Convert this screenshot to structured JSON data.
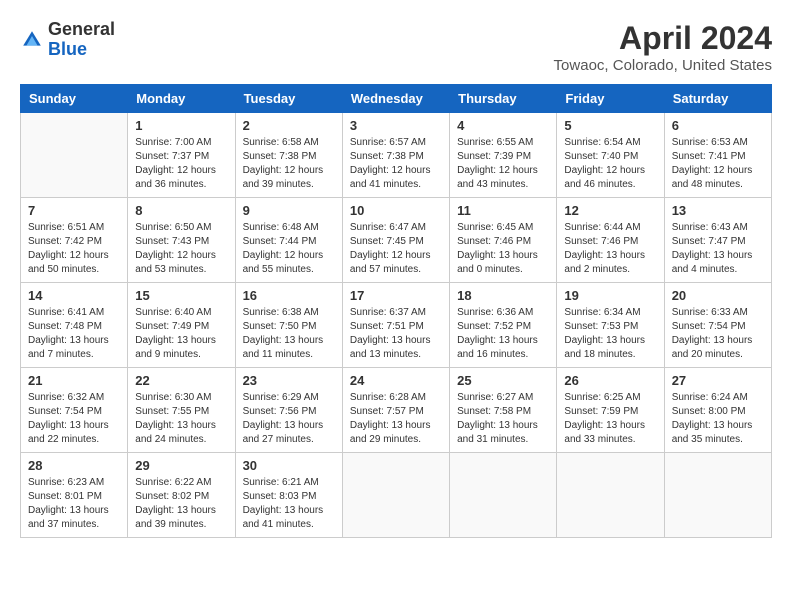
{
  "header": {
    "logo_general": "General",
    "logo_blue": "Blue",
    "month": "April 2024",
    "location": "Towaoc, Colorado, United States"
  },
  "days_of_week": [
    "Sunday",
    "Monday",
    "Tuesday",
    "Wednesday",
    "Thursday",
    "Friday",
    "Saturday"
  ],
  "weeks": [
    [
      {
        "num": "",
        "sunrise": "",
        "sunset": "",
        "daylight": ""
      },
      {
        "num": "1",
        "sunrise": "Sunrise: 7:00 AM",
        "sunset": "Sunset: 7:37 PM",
        "daylight": "Daylight: 12 hours and 36 minutes."
      },
      {
        "num": "2",
        "sunrise": "Sunrise: 6:58 AM",
        "sunset": "Sunset: 7:38 PM",
        "daylight": "Daylight: 12 hours and 39 minutes."
      },
      {
        "num": "3",
        "sunrise": "Sunrise: 6:57 AM",
        "sunset": "Sunset: 7:38 PM",
        "daylight": "Daylight: 12 hours and 41 minutes."
      },
      {
        "num": "4",
        "sunrise": "Sunrise: 6:55 AM",
        "sunset": "Sunset: 7:39 PM",
        "daylight": "Daylight: 12 hours and 43 minutes."
      },
      {
        "num": "5",
        "sunrise": "Sunrise: 6:54 AM",
        "sunset": "Sunset: 7:40 PM",
        "daylight": "Daylight: 12 hours and 46 minutes."
      },
      {
        "num": "6",
        "sunrise": "Sunrise: 6:53 AM",
        "sunset": "Sunset: 7:41 PM",
        "daylight": "Daylight: 12 hours and 48 minutes."
      }
    ],
    [
      {
        "num": "7",
        "sunrise": "Sunrise: 6:51 AM",
        "sunset": "Sunset: 7:42 PM",
        "daylight": "Daylight: 12 hours and 50 minutes."
      },
      {
        "num": "8",
        "sunrise": "Sunrise: 6:50 AM",
        "sunset": "Sunset: 7:43 PM",
        "daylight": "Daylight: 12 hours and 53 minutes."
      },
      {
        "num": "9",
        "sunrise": "Sunrise: 6:48 AM",
        "sunset": "Sunset: 7:44 PM",
        "daylight": "Daylight: 12 hours and 55 minutes."
      },
      {
        "num": "10",
        "sunrise": "Sunrise: 6:47 AM",
        "sunset": "Sunset: 7:45 PM",
        "daylight": "Daylight: 12 hours and 57 minutes."
      },
      {
        "num": "11",
        "sunrise": "Sunrise: 6:45 AM",
        "sunset": "Sunset: 7:46 PM",
        "daylight": "Daylight: 13 hours and 0 minutes."
      },
      {
        "num": "12",
        "sunrise": "Sunrise: 6:44 AM",
        "sunset": "Sunset: 7:46 PM",
        "daylight": "Daylight: 13 hours and 2 minutes."
      },
      {
        "num": "13",
        "sunrise": "Sunrise: 6:43 AM",
        "sunset": "Sunset: 7:47 PM",
        "daylight": "Daylight: 13 hours and 4 minutes."
      }
    ],
    [
      {
        "num": "14",
        "sunrise": "Sunrise: 6:41 AM",
        "sunset": "Sunset: 7:48 PM",
        "daylight": "Daylight: 13 hours and 7 minutes."
      },
      {
        "num": "15",
        "sunrise": "Sunrise: 6:40 AM",
        "sunset": "Sunset: 7:49 PM",
        "daylight": "Daylight: 13 hours and 9 minutes."
      },
      {
        "num": "16",
        "sunrise": "Sunrise: 6:38 AM",
        "sunset": "Sunset: 7:50 PM",
        "daylight": "Daylight: 13 hours and 11 minutes."
      },
      {
        "num": "17",
        "sunrise": "Sunrise: 6:37 AM",
        "sunset": "Sunset: 7:51 PM",
        "daylight": "Daylight: 13 hours and 13 minutes."
      },
      {
        "num": "18",
        "sunrise": "Sunrise: 6:36 AM",
        "sunset": "Sunset: 7:52 PM",
        "daylight": "Daylight: 13 hours and 16 minutes."
      },
      {
        "num": "19",
        "sunrise": "Sunrise: 6:34 AM",
        "sunset": "Sunset: 7:53 PM",
        "daylight": "Daylight: 13 hours and 18 minutes."
      },
      {
        "num": "20",
        "sunrise": "Sunrise: 6:33 AM",
        "sunset": "Sunset: 7:54 PM",
        "daylight": "Daylight: 13 hours and 20 minutes."
      }
    ],
    [
      {
        "num": "21",
        "sunrise": "Sunrise: 6:32 AM",
        "sunset": "Sunset: 7:54 PM",
        "daylight": "Daylight: 13 hours and 22 minutes."
      },
      {
        "num": "22",
        "sunrise": "Sunrise: 6:30 AM",
        "sunset": "Sunset: 7:55 PM",
        "daylight": "Daylight: 13 hours and 24 minutes."
      },
      {
        "num": "23",
        "sunrise": "Sunrise: 6:29 AM",
        "sunset": "Sunset: 7:56 PM",
        "daylight": "Daylight: 13 hours and 27 minutes."
      },
      {
        "num": "24",
        "sunrise": "Sunrise: 6:28 AM",
        "sunset": "Sunset: 7:57 PM",
        "daylight": "Daylight: 13 hours and 29 minutes."
      },
      {
        "num": "25",
        "sunrise": "Sunrise: 6:27 AM",
        "sunset": "Sunset: 7:58 PM",
        "daylight": "Daylight: 13 hours and 31 minutes."
      },
      {
        "num": "26",
        "sunrise": "Sunrise: 6:25 AM",
        "sunset": "Sunset: 7:59 PM",
        "daylight": "Daylight: 13 hours and 33 minutes."
      },
      {
        "num": "27",
        "sunrise": "Sunrise: 6:24 AM",
        "sunset": "Sunset: 8:00 PM",
        "daylight": "Daylight: 13 hours and 35 minutes."
      }
    ],
    [
      {
        "num": "28",
        "sunrise": "Sunrise: 6:23 AM",
        "sunset": "Sunset: 8:01 PM",
        "daylight": "Daylight: 13 hours and 37 minutes."
      },
      {
        "num": "29",
        "sunrise": "Sunrise: 6:22 AM",
        "sunset": "Sunset: 8:02 PM",
        "daylight": "Daylight: 13 hours and 39 minutes."
      },
      {
        "num": "30",
        "sunrise": "Sunrise: 6:21 AM",
        "sunset": "Sunset: 8:03 PM",
        "daylight": "Daylight: 13 hours and 41 minutes."
      },
      {
        "num": "",
        "sunrise": "",
        "sunset": "",
        "daylight": ""
      },
      {
        "num": "",
        "sunrise": "",
        "sunset": "",
        "daylight": ""
      },
      {
        "num": "",
        "sunrise": "",
        "sunset": "",
        "daylight": ""
      },
      {
        "num": "",
        "sunrise": "",
        "sunset": "",
        "daylight": ""
      }
    ]
  ]
}
